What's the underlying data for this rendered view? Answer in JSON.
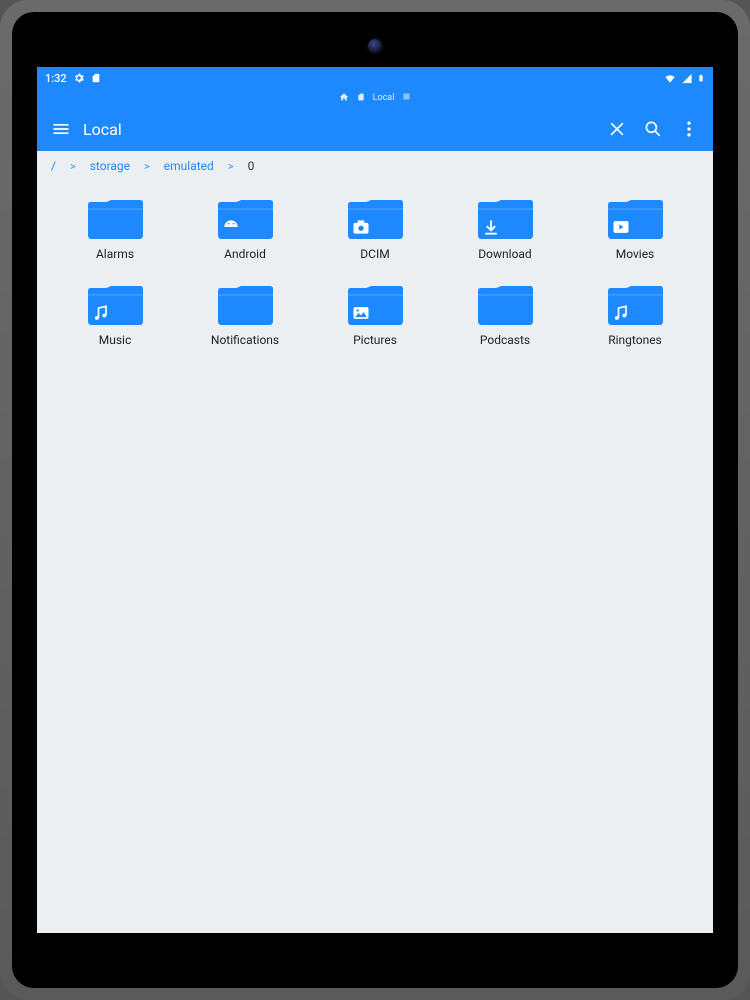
{
  "status": {
    "time": "1:32"
  },
  "tabstrip": {
    "label": "Local"
  },
  "appbar": {
    "title": "Local"
  },
  "breadcrumb": {
    "segments": [
      "/",
      "storage",
      "emulated",
      "0"
    ]
  },
  "folders": [
    {
      "label": "Alarms",
      "icon": "none"
    },
    {
      "label": "Android",
      "icon": "android"
    },
    {
      "label": "DCIM",
      "icon": "camera"
    },
    {
      "label": "Download",
      "icon": "download"
    },
    {
      "label": "Movies",
      "icon": "play"
    },
    {
      "label": "Music",
      "icon": "music"
    },
    {
      "label": "Notifications",
      "icon": "none"
    },
    {
      "label": "Pictures",
      "icon": "picture"
    },
    {
      "label": "Podcasts",
      "icon": "none"
    },
    {
      "label": "Ringtones",
      "icon": "music"
    }
  ],
  "colors": {
    "accent": "#1e88ff",
    "bg": "#eceff1"
  }
}
